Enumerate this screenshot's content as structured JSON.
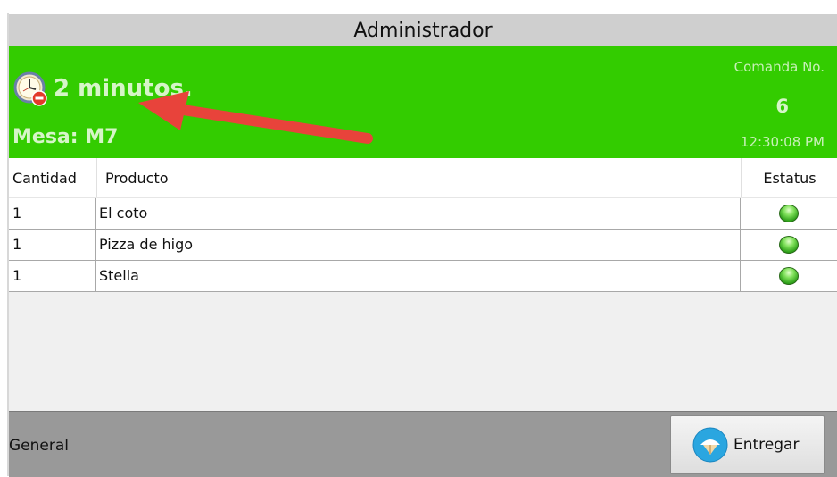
{
  "window": {
    "title": "Administrador"
  },
  "header": {
    "elapsed": "2 minutos.",
    "table_label": "Mesa: M7",
    "order_label": "Comanda No.",
    "order_number": "6",
    "time": "12:30:08 PM",
    "background_color": "#33cc00"
  },
  "table": {
    "columns": [
      "Cantidad",
      "Producto",
      "Estatus"
    ],
    "rows": [
      {
        "cantidad": "1",
        "producto": "El coto",
        "estatus": "green-status-icon"
      },
      {
        "cantidad": "1",
        "producto": "Pizza de higo",
        "estatus": "green-status-icon"
      },
      {
        "cantidad": "1",
        "producto": "Stella",
        "estatus": "green-status-icon"
      }
    ]
  },
  "footer": {
    "category": "General",
    "deliver_label": "Entregar"
  }
}
